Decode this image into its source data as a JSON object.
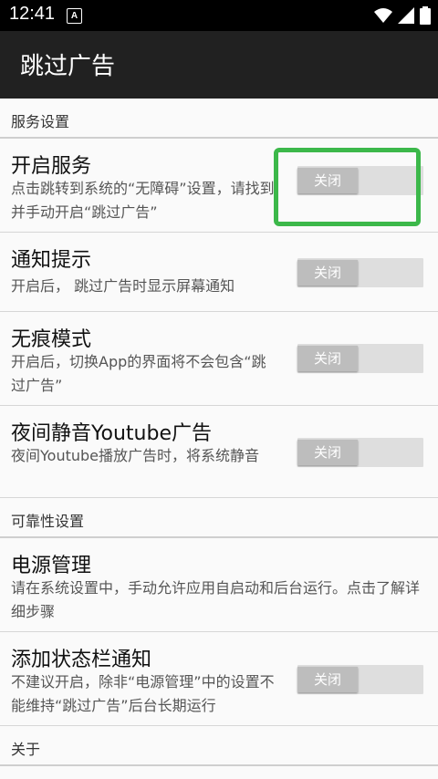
{
  "status": {
    "time": "12:41",
    "notif_icon": "A"
  },
  "appbar": {
    "title": "跳过广告"
  },
  "sections": {
    "service": "服务设置",
    "reliability": "可靠性设置",
    "about": "关于"
  },
  "rows": {
    "start_service": {
      "title": "开启服务",
      "desc": "点击跳转到系统的“无障碍”设置，请找到并手动开启“跳过广告”",
      "toggle": "关闭"
    },
    "notify": {
      "title": "通知提示",
      "desc": "开启后， 跳过广告时显示屏幕通知",
      "toggle": "关闭"
    },
    "incognito": {
      "title": "无痕模式",
      "desc": "开启后，切换App的界面将不会包含“跳过广告”",
      "toggle": "关闭"
    },
    "night_mute": {
      "title": "夜间静音Youtube广告",
      "desc": "夜间Youtube播放广告时，将系统静音",
      "toggle": "关闭"
    },
    "power": {
      "title": "电源管理",
      "desc": "请在系统设置中，手动允许应用自启动和后台运行。点击了解详细步骤"
    },
    "statusbar_notify": {
      "title": "添加状态栏通知",
      "desc": "不建议开启，除非“电源管理”中的设置不能维持“跳过广告”后台长期运行",
      "toggle": "关闭"
    }
  },
  "colors": {
    "highlight": "#3cb84a",
    "appbar": "#212121"
  }
}
